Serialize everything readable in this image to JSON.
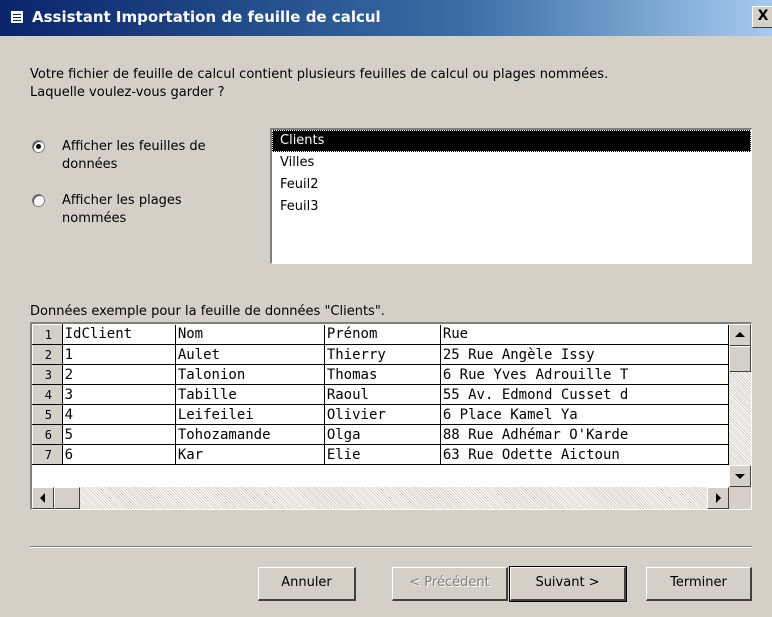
{
  "window": {
    "title": "Assistant Importation de feuille de calcul",
    "close_label": "X"
  },
  "description": {
    "line1": "Votre fichier de feuille de calcul contient plusieurs feuilles de calcul ou plages nommées.",
    "line2": "Laquelle voulez-vous garder ?"
  },
  "options": [
    {
      "label": "Afficher les feuilles de données",
      "checked": true
    },
    {
      "label": "Afficher les plages nommées",
      "checked": false
    }
  ],
  "sheets": {
    "items": [
      "Clients",
      "Villes",
      "Feuil2",
      "Feuil3"
    ],
    "selected": "Clients"
  },
  "sample_label": "Données exemple pour la feuille de données \"Clients\".",
  "sample_table": {
    "row_numbers": [
      "1",
      "2",
      "3",
      "4",
      "5",
      "6",
      "7"
    ],
    "rows": [
      [
        "IdClient",
        "Nom",
        "Prénom",
        "Rue"
      ],
      [
        "1",
        "Aulet",
        "Thierry",
        "25 Rue Angèle Issy"
      ],
      [
        "2",
        "Talonion",
        "Thomas",
        "6 Rue Yves Adrouille T"
      ],
      [
        "3",
        "Tabille",
        "Raoul",
        "55 Av. Edmond Cusset d"
      ],
      [
        "4",
        "Leifeilei",
        "Olivier",
        "6 Place Kamel Ya"
      ],
      [
        "5",
        "Tohozamande",
        "Olga",
        "88 Rue Adhémar O'Karde"
      ],
      [
        "6",
        "Kar",
        "Elie",
        "63 Rue Odette Aictoun"
      ]
    ]
  },
  "buttons": {
    "cancel": "Annuler",
    "previous": "< Précédent",
    "next": "Suivant >",
    "finish": "Terminer"
  }
}
